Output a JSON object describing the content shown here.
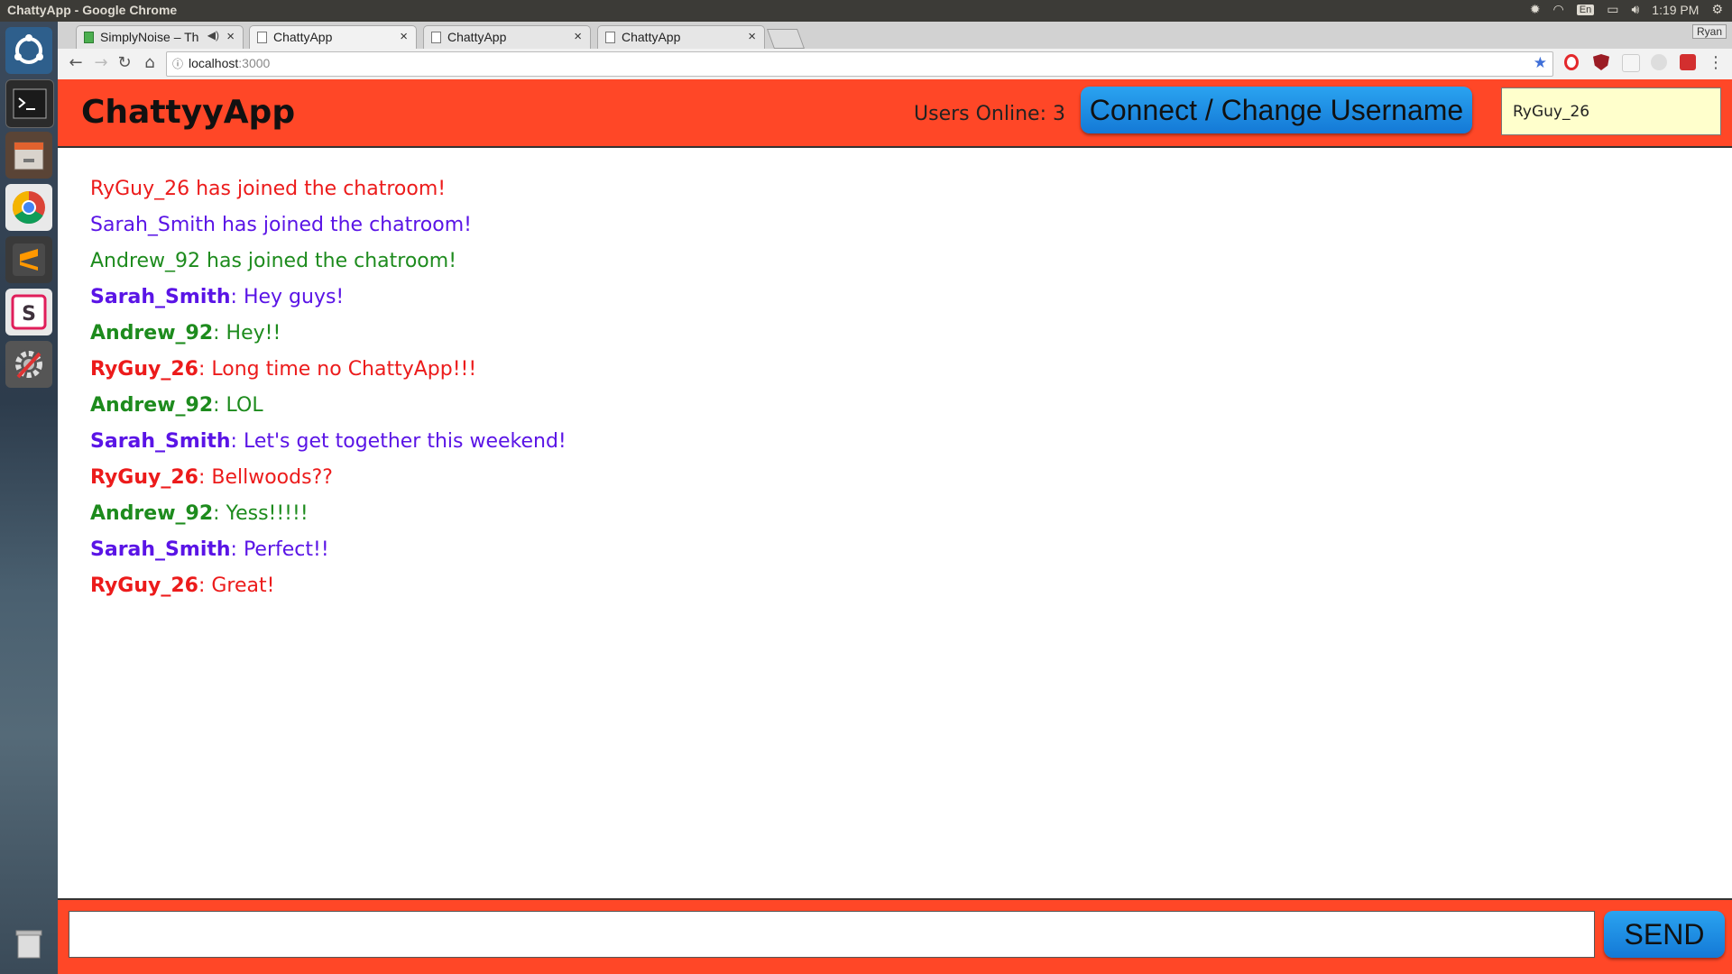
{
  "os": {
    "window_title": "ChattyApp - Google Chrome",
    "clock": "1:19 PM",
    "keyboard_layout": "En",
    "launcher": [
      "ubuntu-dash-icon",
      "terminal-icon",
      "file-manager-icon",
      "chrome-icon",
      "sublime-text-icon",
      "slack-icon",
      "system-settings-icon",
      "trash-icon"
    ]
  },
  "browser": {
    "tabs": [
      {
        "label": "SimplyNoise – Th",
        "favicon": "audio-green"
      },
      {
        "label": "ChattyApp",
        "favicon": "page"
      },
      {
        "label": "ChattyApp",
        "favicon": "page"
      },
      {
        "label": "ChattyApp",
        "favicon": "page"
      }
    ],
    "profile": "Ryan",
    "url_host": "localhost",
    "url_port": ":3000"
  },
  "app": {
    "brand": "ChattyyApp",
    "users_online": "Users Online: 3",
    "connect_label": "Connect / Change Username",
    "username_value": "RyGuy_26",
    "message_placeholder": "",
    "send_label": "SEND",
    "colors": {
      "RyGuy_26": "#ec1b1b",
      "Sarah_Smith": "#5a14e6",
      "Andrew_92": "#1d8b1d",
      "brand_bar": "#ff4727",
      "button": "#1e8fe6"
    },
    "messages": [
      {
        "type": "system",
        "user": "RyGuy_26",
        "text": "RyGuy_26 has joined the chatroom!"
      },
      {
        "type": "system",
        "user": "Sarah_Smith",
        "text": "Sarah_Smith has joined the chatroom!"
      },
      {
        "type": "system",
        "user": "Andrew_92",
        "text": "Andrew_92 has joined the chatroom!"
      },
      {
        "type": "chat",
        "user": "Sarah_Smith",
        "text": ": Hey guys!"
      },
      {
        "type": "chat",
        "user": "Andrew_92",
        "text": ": Hey!!"
      },
      {
        "type": "chat",
        "user": "RyGuy_26",
        "text": ": Long time no ChattyApp!!!"
      },
      {
        "type": "chat",
        "user": "Andrew_92",
        "text": ": LOL"
      },
      {
        "type": "chat",
        "user": "Sarah_Smith",
        "text": ": Let's get together this weekend!"
      },
      {
        "type": "chat",
        "user": "RyGuy_26",
        "text": ": Bellwoods??"
      },
      {
        "type": "chat",
        "user": "Andrew_92",
        "text": ": Yess!!!!!"
      },
      {
        "type": "chat",
        "user": "Sarah_Smith",
        "text": ": Perfect!!"
      },
      {
        "type": "chat",
        "user": "RyGuy_26",
        "text": ": Great!"
      }
    ]
  }
}
